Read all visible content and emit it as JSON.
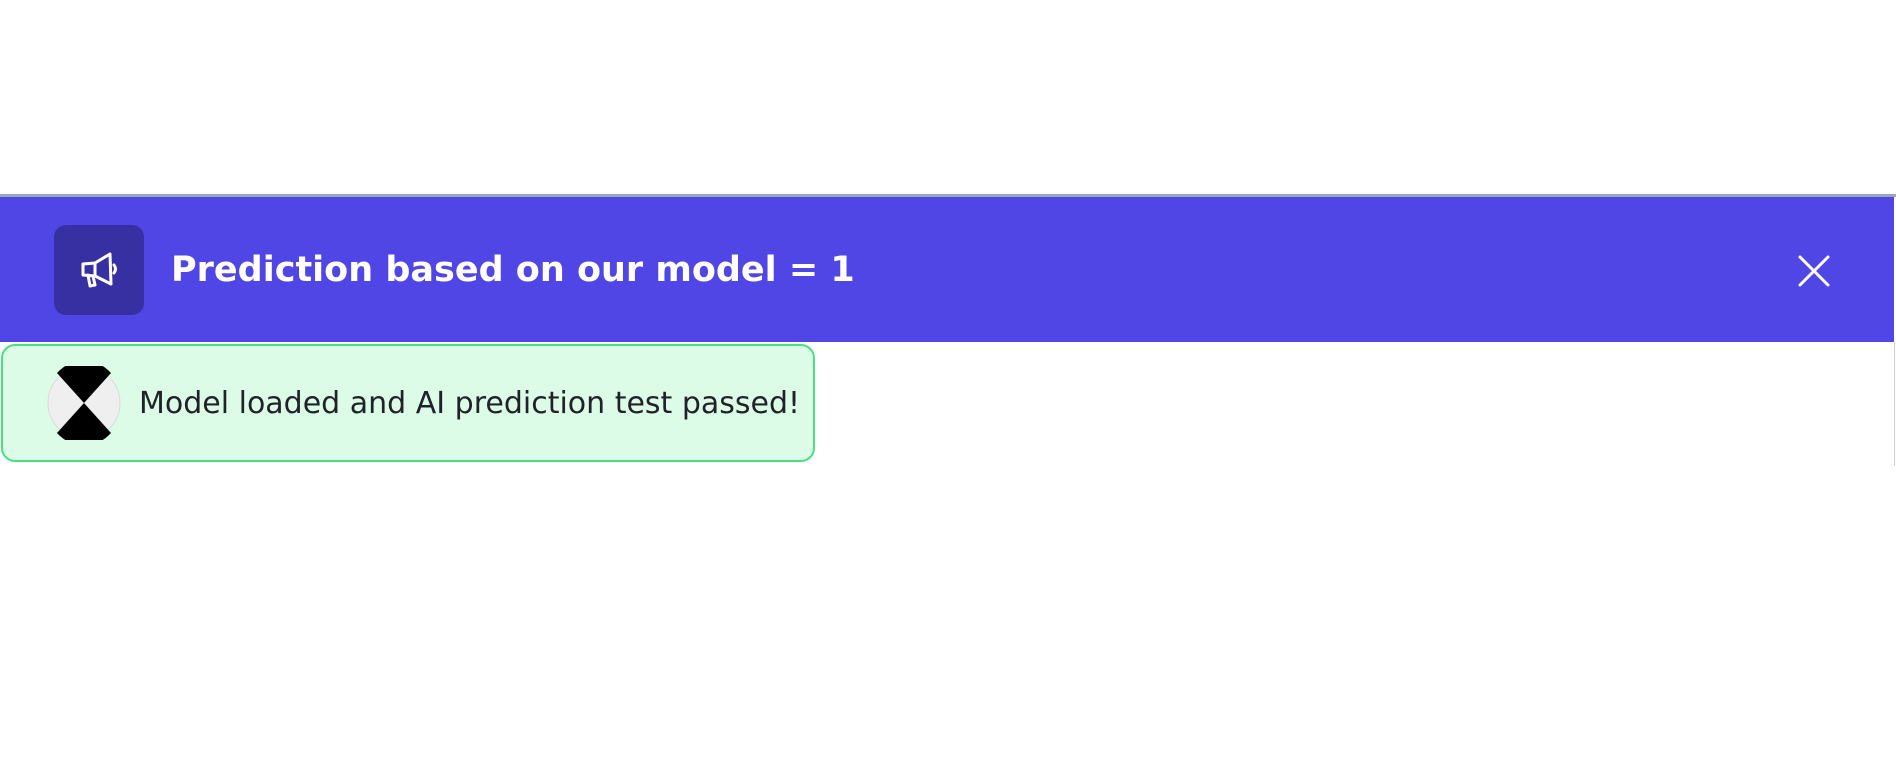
{
  "banner": {
    "message": "Prediction based on our model = 1",
    "icon": "megaphone-icon",
    "close_icon": "close-icon",
    "background_color": "#4f46e5",
    "icon_background_color": "#3730a3"
  },
  "toast": {
    "message": "Model loaded and AI prediction test passed!",
    "icon": "spinner-icon",
    "background_color": "#dcfce7",
    "border_color": "#4ade80"
  }
}
